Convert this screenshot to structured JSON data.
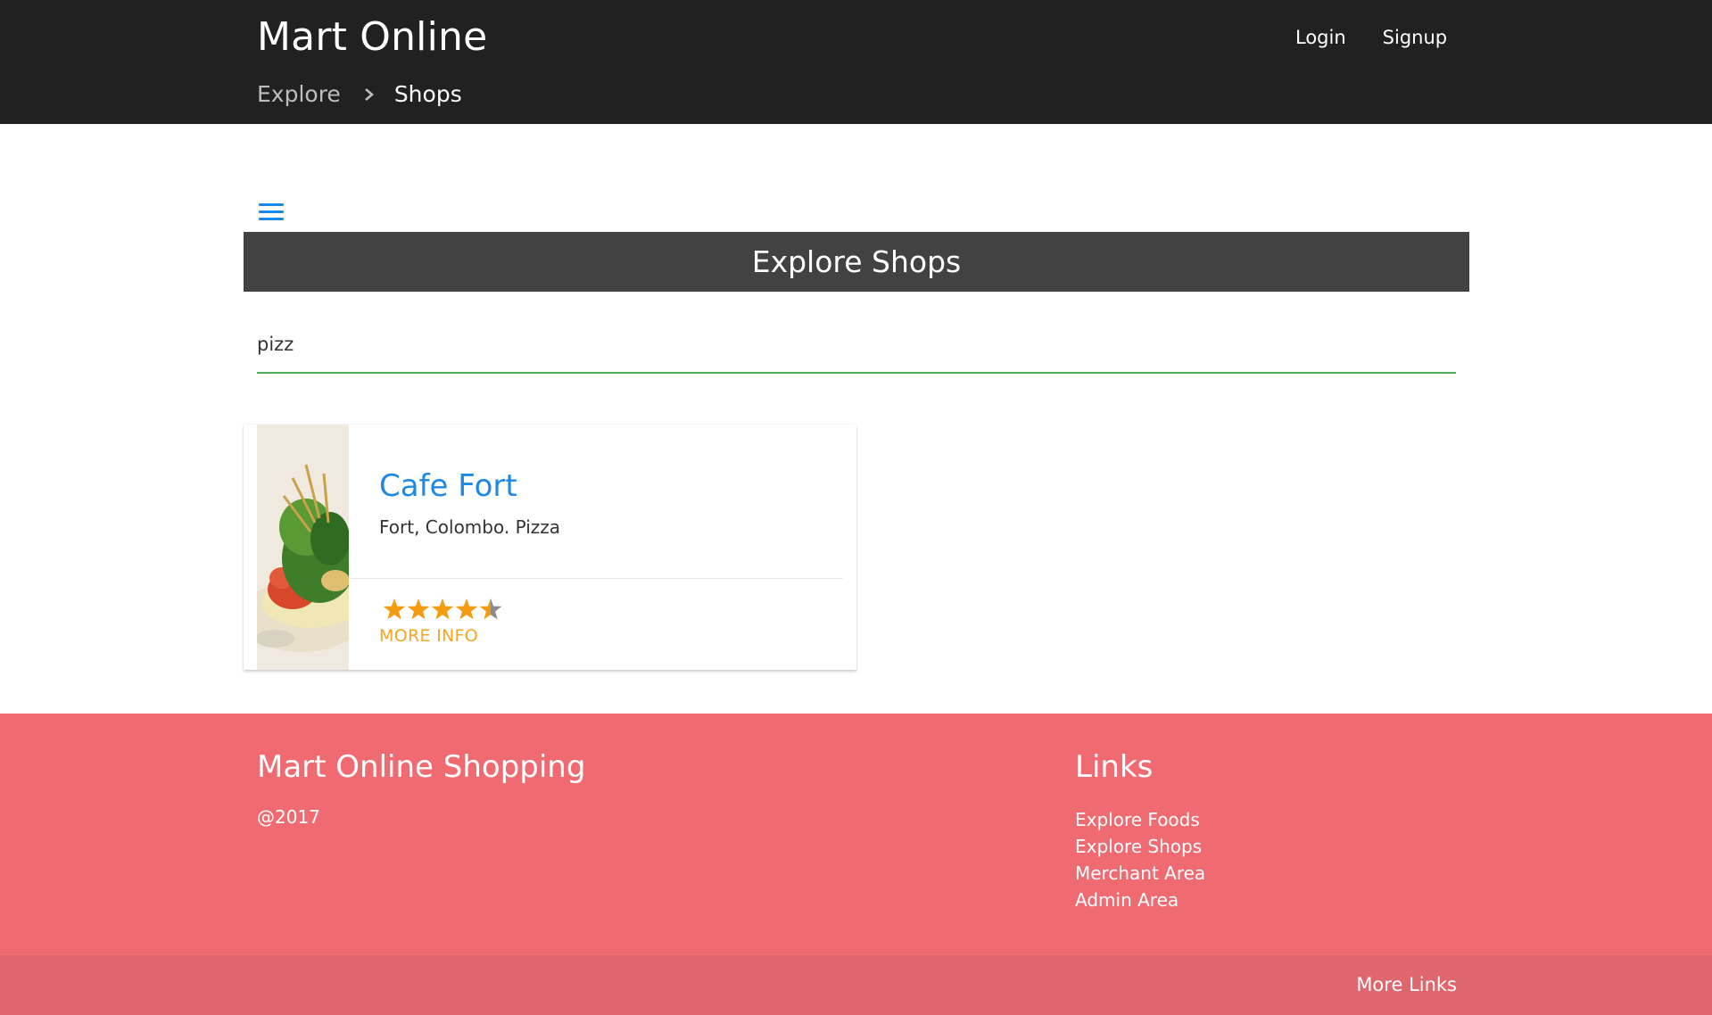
{
  "header": {
    "brand": "Mart Online",
    "nav": {
      "login": "Login",
      "signup": "Signup"
    },
    "breadcrumb": {
      "parent": "Explore",
      "current": "Shops"
    }
  },
  "main": {
    "menu_icon": "hamburger-menu-icon",
    "title": "Explore Shops",
    "search": {
      "value": "pizz"
    },
    "shops": [
      {
        "name": "Cafe Fort",
        "description": "Fort, Colombo. Pizza",
        "rating": 4.5,
        "rating_max": 5,
        "more_label": "MORE INFO"
      }
    ]
  },
  "footer": {
    "title": "Mart Online Shopping",
    "copyright": "@2017",
    "links_title": "Links",
    "links": [
      "Explore Foods",
      "Explore Shops",
      "Merchant Area",
      "Admin Area"
    ],
    "more_links": "More Links"
  },
  "colors": {
    "header_bg": "#212121",
    "title_bar_bg": "#424242",
    "link_blue": "#1e88e5",
    "search_underline": "#4caf50",
    "star_orange": "#f39c12",
    "more_info": "#f5a623",
    "footer_bg": "#ef6b71",
    "footer_bottom_bg": "#e0666d"
  }
}
